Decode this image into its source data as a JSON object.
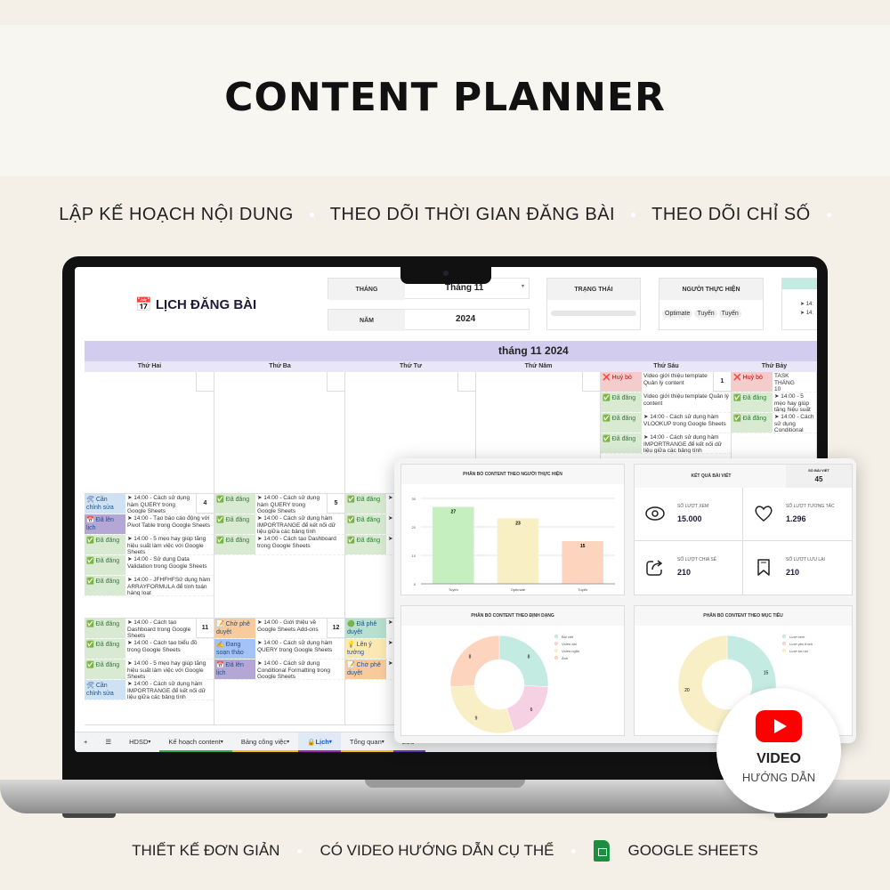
{
  "hero": {
    "title": "CONTENT PLANNER",
    "features": [
      "LẬP KẾ HOẠCH NỘI DUNG",
      "THEO DÕI THỜI GIAN ĐĂNG BÀI",
      "THEO DÕI CHỈ SỐ"
    ],
    "bottom_features": [
      "THIẾT KẾ ĐƠN GIẢN",
      "CÓ VIDEO HƯỚNG DẪN CỤ THỂ",
      "GOOGLE SHEETS"
    ]
  },
  "sheet": {
    "title": "LỊCH ĐĂNG BÀI",
    "title_icon": "calendar-icon",
    "filters": {
      "month_label": "THÁNG",
      "month_value": "Tháng 11",
      "year_label": "NĂM",
      "year_value": "2024",
      "status_label": "TRẠNG THÁI",
      "assignee_label": "NGƯỜI THỰC HIỆN",
      "assignee_chips": [
        "Optimate",
        "Tuyến",
        "Tuyến"
      ],
      "extra_lines": [
        "➤ 14:",
        "➤ 14:"
      ]
    },
    "month_header": "tháng 11 2024",
    "days": [
      "Thứ Hai",
      "Thứ Ba",
      "Thứ Tư",
      "Thứ Năm",
      "Thứ Sáu",
      "Thứ Bảy"
    ],
    "status_colors": {
      "Đã đăng": "#d9ead3",
      "Cần chỉnh sửa": "#cfe2f3",
      "Đã lên lịch": "#b4a7d6",
      "Huỷ bỏ": "#f4cccc",
      "Chờ phê duyệt": "#f9cb9c",
      "Đang soạn thảo": "#a4c2f4",
      "Đã phê duyệt": "#b7e1cd",
      "Lên ý tưởng": "#fce8b2"
    },
    "weeks": [
      {
        "cells": [
          {
            "date": "",
            "entries": []
          },
          {
            "date": "",
            "entries": []
          },
          {
            "date": "",
            "entries": []
          },
          {
            "date": "",
            "entries": []
          },
          {
            "date": "1",
            "entries": [
              {
                "status": "Huỷ bỏ",
                "icon": "❌",
                "text": "Video giới thiệu template Quản lý content"
              },
              {
                "status": "Đã đăng",
                "icon": "✅",
                "text": "Video giới thiệu template Quản lý content"
              },
              {
                "status": "Đã đăng",
                "icon": "✅",
                "text": "➤ 14:00 - Cách sử dụng hàm VLOOKUP trong Google Sheets"
              },
              {
                "status": "Đã đăng",
                "icon": "✅",
                "text": "➤ 14:00 - Cách sử dụng hàm IMPORTRANGE để kết nối dữ liệu giữa các bảng tính"
              }
            ]
          },
          {
            "date": "",
            "entries": [
              {
                "status": "Huỷ bỏ",
                "icon": "❌",
                "text": "TASK THÁNG 10"
              },
              {
                "status": "Đã đăng",
                "icon": "✅",
                "text": "➤ 14:00 - 5 mẹo hay giúp tăng hiệu suất làm việc với Google Sheets"
              },
              {
                "status": "Đã đăng",
                "icon": "✅",
                "text": "➤ 14:00 - Cách sử dụng Conditional Formatting trong Google Sheets"
              }
            ]
          }
        ]
      },
      {
        "cells": [
          {
            "date": "4",
            "entries": [
              {
                "status": "Cần chỉnh sửa",
                "icon": "🛠",
                "text": "➤ 14:00 - Cách sử dụng hàm QUERY trong Google Sheets"
              },
              {
                "status": "Đã lên lịch",
                "icon": "📅",
                "text": "➤ 14:00 - Tạo báo cáo động với Pivot Table trong Google Sheets"
              },
              {
                "status": "Đã đăng",
                "icon": "✅",
                "text": "➤ 14:00 - 5 mẹo hay giúp tăng hiệu suất làm việc với Google Sheets"
              },
              {
                "status": "Đã đăng",
                "icon": "✅",
                "text": "➤ 14:00 - Sử dụng Data Validation trong Google Sheets"
              },
              {
                "status": "Đã đăng",
                "icon": "✅",
                "text": "➤ 14:00 - JFHFHFSử dụng hàm ARRAYFORMULA để tính toán hàng loạt"
              }
            ]
          },
          {
            "date": "5",
            "entries": [
              {
                "status": "Đã đăng",
                "icon": "✅",
                "text": "➤ 14:00 - Cách sử dụng hàm QUERY trong Google Sheets"
              },
              {
                "status": "Đã đăng",
                "icon": "✅",
                "text": "➤ 14:00 - Cách sử dụng hàm IMPORTRANGE để kết nối dữ liệu giữa các bảng tính"
              },
              {
                "status": "Đã đăng",
                "icon": "✅",
                "text": "➤ 14:00 - Cách tạo Dashboard trong Google Sheets"
              }
            ]
          },
          {
            "date": "",
            "entries": [
              {
                "status": "Đã đăng",
                "icon": "✅",
                "text": "➤ V S"
              },
              {
                "status": "Đã đăng",
                "icon": "✅",
                "text": "➤ C C"
              },
              {
                "status": "Đã đăng",
                "icon": "✅",
                "text": "➤ S"
              }
            ]
          },
          {
            "date": "",
            "entries": []
          },
          {
            "date": "",
            "entries": []
          },
          {
            "date": "",
            "entries": []
          }
        ]
      },
      {
        "cells": [
          {
            "date": "11",
            "entries": [
              {
                "status": "Đã đăng",
                "icon": "✅",
                "text": "➤ 14:00 - Cách tạo Dashboard trong Google Sheets"
              },
              {
                "status": "Đã đăng",
                "icon": "✅",
                "text": "➤ 14:00 - Cách tạo biểu đồ trong Google Sheets"
              },
              {
                "status": "Đã đăng",
                "icon": "✅",
                "text": "➤ 14:00 - 5 mẹo hay giúp tăng hiệu suất làm việc với Google Sheets"
              },
              {
                "status": "Cần chỉnh sửa",
                "icon": "🛠",
                "text": "➤ 14:00 - Cách sử dụng hàm IMPORTRANGE để kết nối dữ liệu giữa các bảng tính"
              }
            ]
          },
          {
            "date": "12",
            "entries": [
              {
                "status": "Chờ phê duyệt",
                "icon": "📝",
                "text": "➤ 14:00 - Giới thiệu về Google Sheets Add-ons"
              },
              {
                "status": "Đang soạn thảo",
                "icon": "✍",
                "text": "➤ 14:00 - Cách sử dụng hàm QUERY trong Google Sheets"
              },
              {
                "status": "Đã lên lịch",
                "icon": "📅",
                "text": "➤ 14:00 - Cách sử dụng Conditional Formatting trong Google Sheets"
              }
            ]
          },
          {
            "date": "",
            "entries": [
              {
                "status": "Đã phê duyệt",
                "icon": "🟢",
                "text": "➤ d"
              },
              {
                "status": "Lên ý tưởng",
                "icon": "💡",
                "text": "➤ V S"
              },
              {
                "status": "Chờ phê duyệt",
                "icon": "📝",
                "text": "➤ V S"
              }
            ]
          },
          {
            "date": "",
            "entries": []
          },
          {
            "date": "",
            "entries": []
          },
          {
            "date": "",
            "entries": []
          }
        ]
      }
    ],
    "tabs": [
      {
        "label": "HDSD",
        "color": "transparent"
      },
      {
        "label": "Kế hoạch content",
        "color": "#34a853"
      },
      {
        "label": "Bảng công việc",
        "color": "#fbbc04"
      },
      {
        "label": "Lịch",
        "color": "#9c27b0",
        "active": true,
        "locked": true
      },
      {
        "label": "Tổng quan",
        "color": "#fbbc04"
      },
      {
        "label": "Lưu",
        "color": "#673ab7"
      }
    ]
  },
  "dashboard": {
    "kpi": {
      "title": "KẾT QUẢ BÀI VIẾT",
      "posts_label": "SỐ BÀI VIẾT",
      "posts_value": "45",
      "items": [
        {
          "label": "SỐ LƯỢT XEM",
          "value": "15.000",
          "icon": "eye-icon"
        },
        {
          "label": "SỐ LƯỢT TƯƠNG TÁC",
          "value": "1.296",
          "icon": "heart-icon"
        },
        {
          "label": "SỐ LƯỢT CHIA SẺ",
          "value": "210",
          "icon": "share-icon"
        },
        {
          "label": "SỐ LƯỢT LƯU LẠI",
          "value": "210",
          "icon": "bookmark-icon"
        }
      ]
    }
  },
  "chart_data": [
    {
      "type": "bar",
      "title": "PHÂN BỔ CONTENT THEO NGƯỜI THỰC HIỆN",
      "categories": [
        "Tuyến",
        "Optimate",
        "Tuyến"
      ],
      "values": [
        27,
        23,
        15
      ],
      "colors": [
        "#c6efc0",
        "#f8efc4",
        "#fdd5be"
      ],
      "ylim": [
        0,
        30
      ],
      "yticks": [
        0,
        10,
        20,
        30
      ],
      "grid": true
    },
    {
      "type": "pie",
      "donut": true,
      "title": "PHÂN BỔ CONTENT THEO ĐỊNH DẠNG",
      "labels": [
        "Bài viết",
        "Video dài",
        "Video ngắn",
        "Ảnh"
      ],
      "values": [
        8,
        6,
        9,
        8
      ],
      "colors": [
        "#c4ebe2",
        "#f6d0e3",
        "#f8efc6",
        "#fdd5be"
      ],
      "legend": "top-right"
    },
    {
      "type": "pie",
      "donut": true,
      "title": "PHÂN BỔ CONTENT THEO MỤC TIÊU",
      "labels": [
        "Lượt xem",
        "Lượt yêu thích",
        "Lượt lưu lại"
      ],
      "values": [
        15,
        2,
        20
      ],
      "value_labels": [
        "15",
        "",
        "20"
      ],
      "colors": [
        "#c4ebe2",
        "#f6d0e3",
        "#f8efc6"
      ],
      "legend": "top-right"
    }
  ],
  "video_badge": {
    "title": "VIDEO",
    "subtitle": "HƯỚNG DẪN",
    "icon": "youtube-play-icon"
  }
}
